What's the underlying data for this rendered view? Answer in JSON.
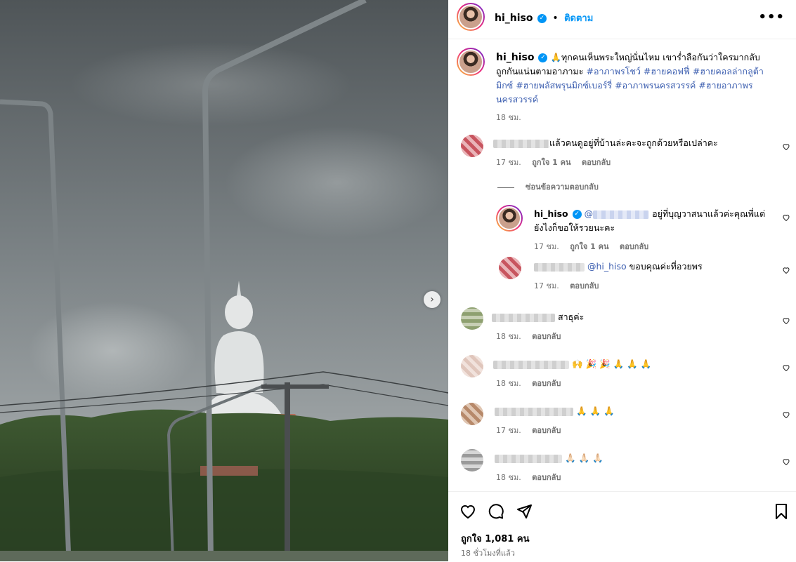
{
  "post": {
    "username": "hi_hiso",
    "follow_label": "ติดตาม",
    "dot": "•",
    "more_label": "•••",
    "caption_emoji": "🙏",
    "caption_text": "ทุกคนเห็นพระใหญ่นั่นไหม เขาร่ำลือกันว่าใครมากลับถูกกันแน่นตามอาภามะ",
    "caption_tags": "#อาภาพรโชว์ #ฮายคอฟฟี่ #ฮายคอลล่ากลูต้ามิกซ์ #ฮายพลัสพรุนมิกซ์เบอร์รี่ #อาภาพรนครสวรรค์ #ฮายอาภาพรนครสวรรค์",
    "caption_time": "18 ชม.",
    "next_label": "›"
  },
  "comments": [
    {
      "text": "แล้วคนดูอยู่ที่บ้านล่ะคะจะถูกด้วยหรือเปล่าคะ",
      "time": "17 ชม.",
      "likes": "ถูกใจ 1 คน",
      "reply": "ตอบกลับ"
    },
    {
      "hide_replies": "ซ่อนข้อความตอบกลับ"
    },
    {
      "username": "hi_hiso",
      "at": "@",
      "text": "อยู่ที่บุญวาสนาแล้วค่ะคุณพี่แต่",
      "text2": "ยังไงก็ขอให้รวยนะคะ",
      "time": "17 ชม.",
      "likes": "ถูกใจ 1 คน",
      "reply": "ตอบกลับ"
    },
    {
      "mention": "@hi_hiso",
      "text": "ขอบคุณค่ะที่อวยพร",
      "time": "17 ชม.",
      "reply": "ตอบกลับ"
    },
    {
      "text": "สาธุค่ะ",
      "time": "18 ชม.",
      "reply": "ตอบกลับ"
    },
    {
      "text": "🙌 🎉 🎉 🙏 🙏 🙏",
      "time": "18 ชม.",
      "reply": "ตอบกลับ"
    },
    {
      "text": "🙏 🙏 🙏",
      "time": "17 ชม.",
      "reply": "ตอบกลับ"
    },
    {
      "text": "🙏🏻 🙏🏻 🙏🏻",
      "time": "18 ชม.",
      "reply": "ตอบกลับ"
    }
  ],
  "footer": {
    "likes": "ถูกใจ 1,081 คน",
    "time_ago": "18 ชั่วโมงที่แล้ว"
  },
  "colors": {
    "link": "#0095f6",
    "hashtag": "#3d5fb0",
    "muted": "#737373"
  }
}
